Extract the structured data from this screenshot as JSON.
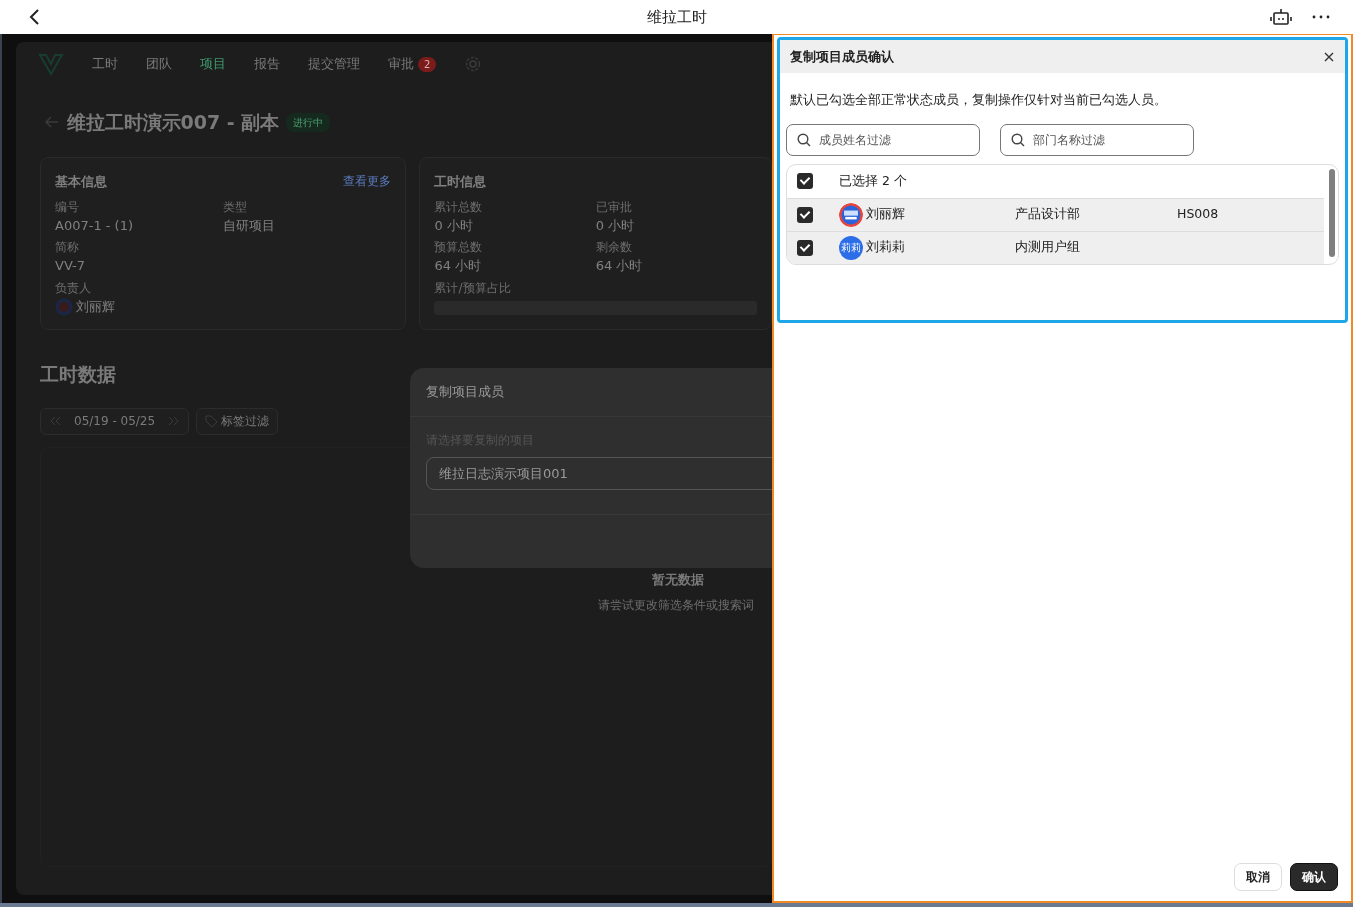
{
  "top_bar": {
    "title": "维拉工时"
  },
  "background_app": {
    "nav": [
      {
        "label": "工时",
        "selected": false
      },
      {
        "label": "团队",
        "selected": false
      },
      {
        "label": "项目",
        "selected": true
      },
      {
        "label": "报告",
        "selected": false
      },
      {
        "label": "提交管理",
        "selected": false
      },
      {
        "label": "审批",
        "selected": false,
        "badge": "2"
      }
    ],
    "project": {
      "title": "维拉工时演示007 - 副本",
      "status": "进行中"
    },
    "basic_info": {
      "title": "基本信息",
      "more_link": "查看更多",
      "fields": [
        {
          "label": "编号",
          "value": "A007-1 - (1)"
        },
        {
          "label": "类型",
          "value": "自研项目"
        },
        {
          "label": "简称",
          "value": "VV-7"
        }
      ],
      "owner": {
        "label": "负责人",
        "name": "刘丽辉"
      }
    },
    "hours_info": {
      "title": "工时信息",
      "fields": [
        {
          "label": "累计总数",
          "value": "0 小时"
        },
        {
          "label": "已审批",
          "value": "0 小时"
        },
        {
          "label": "预算总数",
          "value": "64 小时"
        },
        {
          "label": "剩余数",
          "value": "64 小时"
        }
      ],
      "ratio_label": "累计/预算占比"
    },
    "section_title": "工时数据",
    "date_range": "05/19 - 05/25",
    "tag_filter": "标签过滤",
    "empty": {
      "title": "暂无数据",
      "hint": "请尝试更改筛选条件或搜索词"
    },
    "copy_dialog": {
      "title": "复制项目成员",
      "label": "请选择要复制的项目",
      "value": "维拉日志演示项目001"
    }
  },
  "confirm_dialog": {
    "title": "复制项目成员确认",
    "note": "默认已勾选全部正常状态成员，复制操作仅针对当前已勾选人员。",
    "filters": [
      {
        "placeholder": "成员姓名过滤"
      },
      {
        "placeholder": "部门名称过滤"
      }
    ],
    "select_all": {
      "label": "已选择 2 个",
      "checked": true
    },
    "members": [
      {
        "name": "刘丽辉",
        "department": "产品设计部",
        "code": "HS008",
        "checked": true
      },
      {
        "name": "刘莉莉",
        "department": "内测用户组",
        "avatar": {
          "kind": "text",
          "text": "莉莉"
        },
        "checked": true
      }
    ],
    "buttons": [
      {
        "label": "取消",
        "kind": "secondary"
      },
      {
        "label": "确认",
        "kind": "primary"
      }
    ]
  }
}
